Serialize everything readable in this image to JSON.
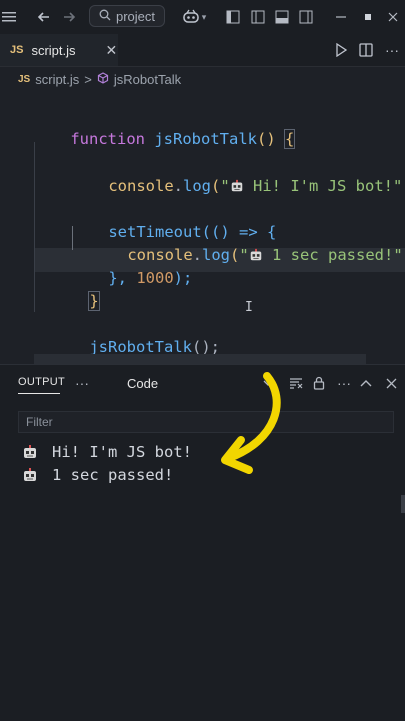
{
  "titlebar": {
    "back_icon": "arrow-left-icon",
    "forward_icon": "arrow-right-icon",
    "search_text": "project",
    "copilot_icon": "copilot-icon"
  },
  "tab": {
    "badge": "JS",
    "label": "script.js",
    "close": "✕"
  },
  "breadcrumb": {
    "file_badge": "JS",
    "file": "script.js",
    "sep": ">",
    "symbol": "jsRobotTalk"
  },
  "code": {
    "l1_kw": "function",
    "l1_fn": "jsRobotTalk",
    "l1_paren": "()",
    "l1_brace": "{",
    "l2_obj": "console",
    "l2_dot": ".",
    "l2_fn": "log",
    "l2_open": "(",
    "l2_q": "\"",
    "l2_text": " Hi! I'm JS bot!\"",
    "l2_close": ");",
    "l3_fn": "setTimeout",
    "l3_rest": "(() => {",
    "l4_obj": "console",
    "l4_dot": ".",
    "l4_fn": "log",
    "l4_open": "(",
    "l4_q": "\"",
    "l4_text": " 1 sec passed!\"",
    "l4_close": ");",
    "l5_a": "}, ",
    "l5_num": "1000",
    "l5_b": ");",
    "l6": "}",
    "l7_fn": "jsRobotTalk",
    "l7_rest": "();"
  },
  "panel": {
    "output_tab": "OUTPUT",
    "more": "···",
    "channel": "Code",
    "filter_placeholder": "Filter",
    "lines": [
      "Hi! I'm JS bot!",
      "1 sec passed!"
    ]
  },
  "colors": {
    "keyword": "#c678dd",
    "function": "#61afef",
    "object": "#e5c07b",
    "string": "#98c379",
    "number": "#d19a66",
    "arrow": "#f2d600"
  }
}
